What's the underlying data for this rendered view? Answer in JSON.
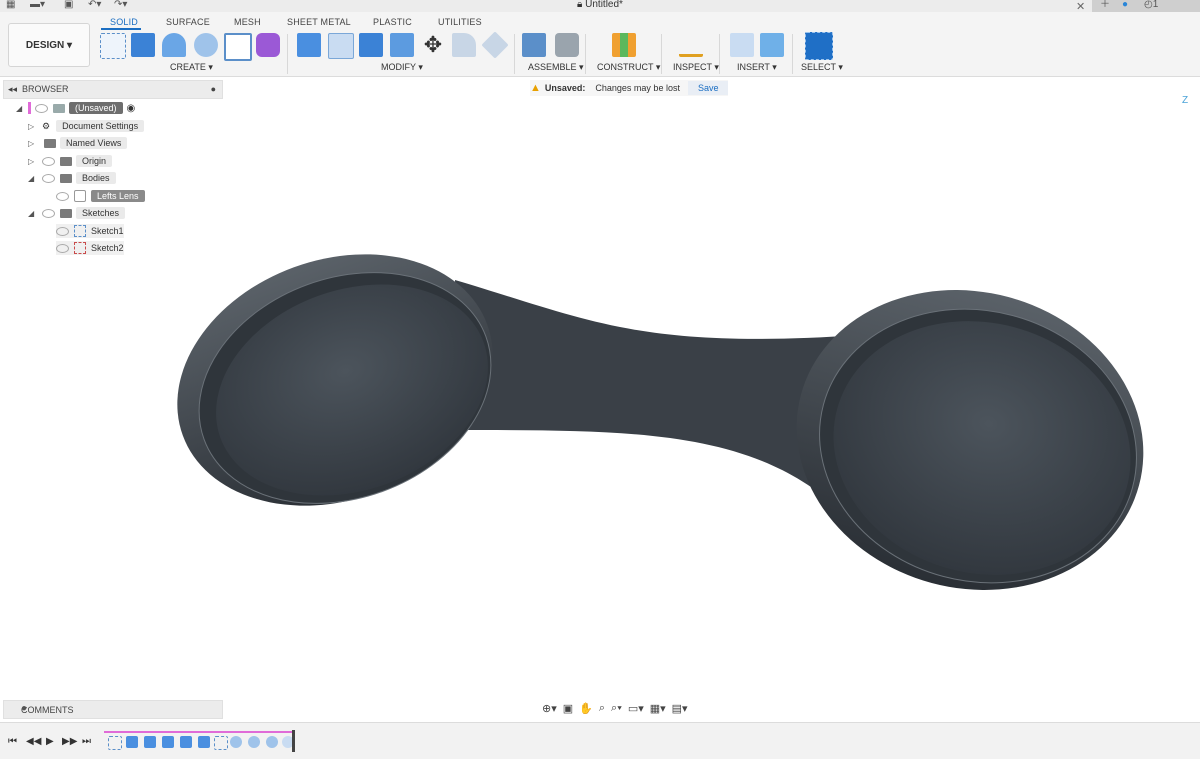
{
  "window": {
    "title": "Untitled*"
  },
  "workspace": {
    "label": "DESIGN"
  },
  "tabs": [
    {
      "label": "SOLID",
      "active": true
    },
    {
      "label": "SURFACE"
    },
    {
      "label": "MESH"
    },
    {
      "label": "SHEET METAL"
    },
    {
      "label": "PLASTIC"
    },
    {
      "label": "UTILITIES"
    }
  ],
  "toolbar_groups": [
    "CREATE",
    "MODIFY",
    "ASSEMBLE",
    "CONSTRUCT",
    "INSPECT",
    "INSERT",
    "SELECT"
  ],
  "browser": {
    "title": "BROWSER",
    "items": [
      {
        "label": "(Unsaved)"
      },
      {
        "label": "Document Settings"
      },
      {
        "label": "Named Views"
      },
      {
        "label": "Origin"
      },
      {
        "label": "Bodies"
      },
      {
        "label": "Lefts Lens"
      },
      {
        "label": "Sketches"
      },
      {
        "label": "Sketch1"
      },
      {
        "label": "Sketch2"
      }
    ]
  },
  "notice": {
    "label": "Unsaved:",
    "message": "Changes may be lost",
    "action": "Save"
  },
  "comments": {
    "title": "COMMENTS"
  },
  "colors": {
    "accent": "#1b6ec2",
    "body": "#3b4148",
    "timeline_bar": "#e06bd8"
  }
}
